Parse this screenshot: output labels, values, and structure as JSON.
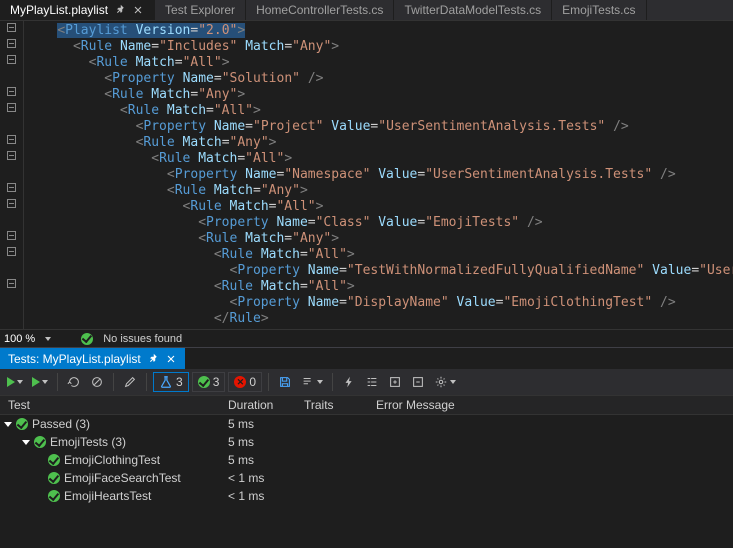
{
  "tabs": [
    {
      "label": "MyPlayList.playlist",
      "active": true,
      "pinned": true
    },
    {
      "label": "Test Explorer"
    },
    {
      "label": "HomeControllerTests.cs"
    },
    {
      "label": "TwitterDataModelTests.cs"
    },
    {
      "label": "EmojiTests.cs"
    }
  ],
  "status": {
    "zoom": "100 %",
    "issues": "No issues found"
  },
  "code": {
    "l1": {
      "el": "Playlist",
      "attrs": [
        [
          "Version",
          "2.0"
        ]
      ]
    },
    "l2": {
      "el": "Rule",
      "attrs": [
        [
          "Name",
          "Includes"
        ],
        [
          "Match",
          "Any"
        ]
      ]
    },
    "l3": {
      "el": "Rule",
      "attrs": [
        [
          "Match",
          "All"
        ]
      ]
    },
    "l4": {
      "el": "Property",
      "attrs": [
        [
          "Name",
          "Solution"
        ]
      ],
      "self": true
    },
    "l5": {
      "el": "Rule",
      "attrs": [
        [
          "Match",
          "Any"
        ]
      ]
    },
    "l6": {
      "el": "Rule",
      "attrs": [
        [
          "Match",
          "All"
        ]
      ]
    },
    "l7": {
      "el": "Property",
      "attrs": [
        [
          "Name",
          "Project"
        ],
        [
          "Value",
          "UserSentimentAnalysis.Tests"
        ]
      ],
      "self": true
    },
    "l8": {
      "el": "Rule",
      "attrs": [
        [
          "Match",
          "Any"
        ]
      ]
    },
    "l9": {
      "el": "Rule",
      "attrs": [
        [
          "Match",
          "All"
        ]
      ]
    },
    "l10": {
      "el": "Property",
      "attrs": [
        [
          "Name",
          "Namespace"
        ],
        [
          "Value",
          "UserSentimentAnalysis.Tests"
        ]
      ],
      "self": true
    },
    "l11": {
      "el": "Rule",
      "attrs": [
        [
          "Match",
          "Any"
        ]
      ]
    },
    "l12": {
      "el": "Rule",
      "attrs": [
        [
          "Match",
          "All"
        ]
      ]
    },
    "l13": {
      "el": "Property",
      "attrs": [
        [
          "Name",
          "Class"
        ],
        [
          "Value",
          "EmojiTests"
        ]
      ],
      "self": true
    },
    "l14": {
      "el": "Rule",
      "attrs": [
        [
          "Match",
          "Any"
        ]
      ]
    },
    "l15": {
      "el": "Rule",
      "attrs": [
        [
          "Match",
          "All"
        ]
      ]
    },
    "l16": {
      "el": "Property",
      "attrs": [
        [
          "Name",
          "TestWithNormalizedFullyQualifiedName"
        ],
        [
          "Value",
          "UserSentimentA"
        ]
      ],
      "self": true,
      "clip": true
    },
    "l17": {
      "el": "Rule",
      "attrs": [
        [
          "Match",
          "All"
        ]
      ]
    },
    "l18": {
      "el": "Property",
      "attrs": [
        [
          "Name",
          "DisplayName"
        ],
        [
          "Value",
          "EmojiClothingTest"
        ]
      ],
      "self": true
    },
    "l19": {
      "close": "Rule"
    }
  },
  "panel": {
    "tab": "Tests: MyPlayList.playlist",
    "counts": {
      "flask": "3",
      "pass": "3",
      "fail": "0"
    },
    "columns": {
      "test": "Test",
      "duration": "Duration",
      "traits": "Traits",
      "err": "Error Message"
    },
    "tree": {
      "root": {
        "name": "Passed (3)",
        "dur": "5 ms"
      },
      "class": {
        "name": "EmojiTests (3)",
        "dur": "5 ms"
      },
      "t1": {
        "name": "EmojiClothingTest",
        "dur": "5 ms"
      },
      "t2": {
        "name": "EmojiFaceSearchTest",
        "dur": "< 1 ms"
      },
      "t3": {
        "name": "EmojiHeartsTest",
        "dur": "< 1 ms"
      }
    }
  }
}
